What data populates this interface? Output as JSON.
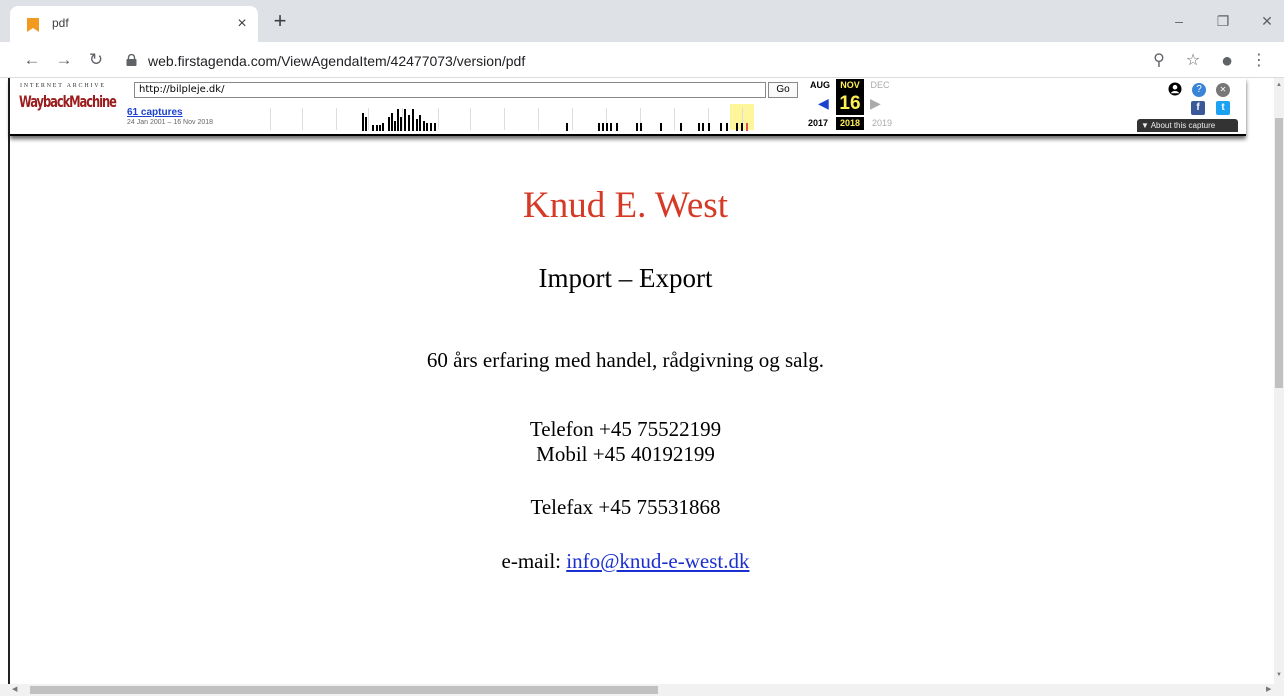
{
  "tab": {
    "title": "pdf",
    "close_glyph": "×",
    "new_tab_glyph": "+"
  },
  "window_controls": {
    "minimize": "–",
    "restore": "❐",
    "close": "✕"
  },
  "toolbar": {
    "back_glyph": "←",
    "forward_glyph": "→",
    "reload_glyph": "↻",
    "url": "web.firstagenda.com/ViewAgendaItem/42477073/version/pdf",
    "zoom_glyph": "⚲",
    "star_glyph": "☆",
    "profile_glyph": "●",
    "menu_glyph": "⋮"
  },
  "wayback": {
    "ia_label": "INTERNET ARCHIVE",
    "logo": "WaybackMachine",
    "url_value": "http://bilpleje.dk/",
    "go_label": "Go",
    "captures_label": "61 captures",
    "captures_range": "24 Jan 2001 – 16 Nov 2018",
    "month_prev": "AUG",
    "month_current": "NOV",
    "month_next": "DEC",
    "day": "16",
    "year_prev": "2017",
    "year_current": "2018",
    "year_next": "2019",
    "prev_glyph": "◀",
    "next_glyph": "▶",
    "about_label": "▼ About this capture",
    "help_glyph": "?",
    "close_glyph": "✕",
    "fb_glyph": "f",
    "tw_glyph": "t"
  },
  "page": {
    "heading": "Knud E. West",
    "subheading": "Import – Export",
    "tagline": "60 års erfaring med handel, rådgivning og salg.",
    "phone": "Telefon +45 75522199",
    "mobile": "Mobil +45 40192199",
    "fax": "Telefax +45 75531868",
    "email_label": "e-mail: ",
    "email": "info@knud-e-west.dk"
  },
  "colors": {
    "heading": "#d53a26",
    "link": "#1b2fd1",
    "wayback_accent": "#ffee55",
    "tab_strip": "#dee1e6"
  },
  "icons": {
    "favicon": "bookmark-orange-icon",
    "lock": "lock-icon",
    "user": "user-circle-icon",
    "help": "help-icon",
    "close": "close-circle-icon",
    "facebook": "facebook-icon",
    "twitter": "twitter-icon"
  }
}
